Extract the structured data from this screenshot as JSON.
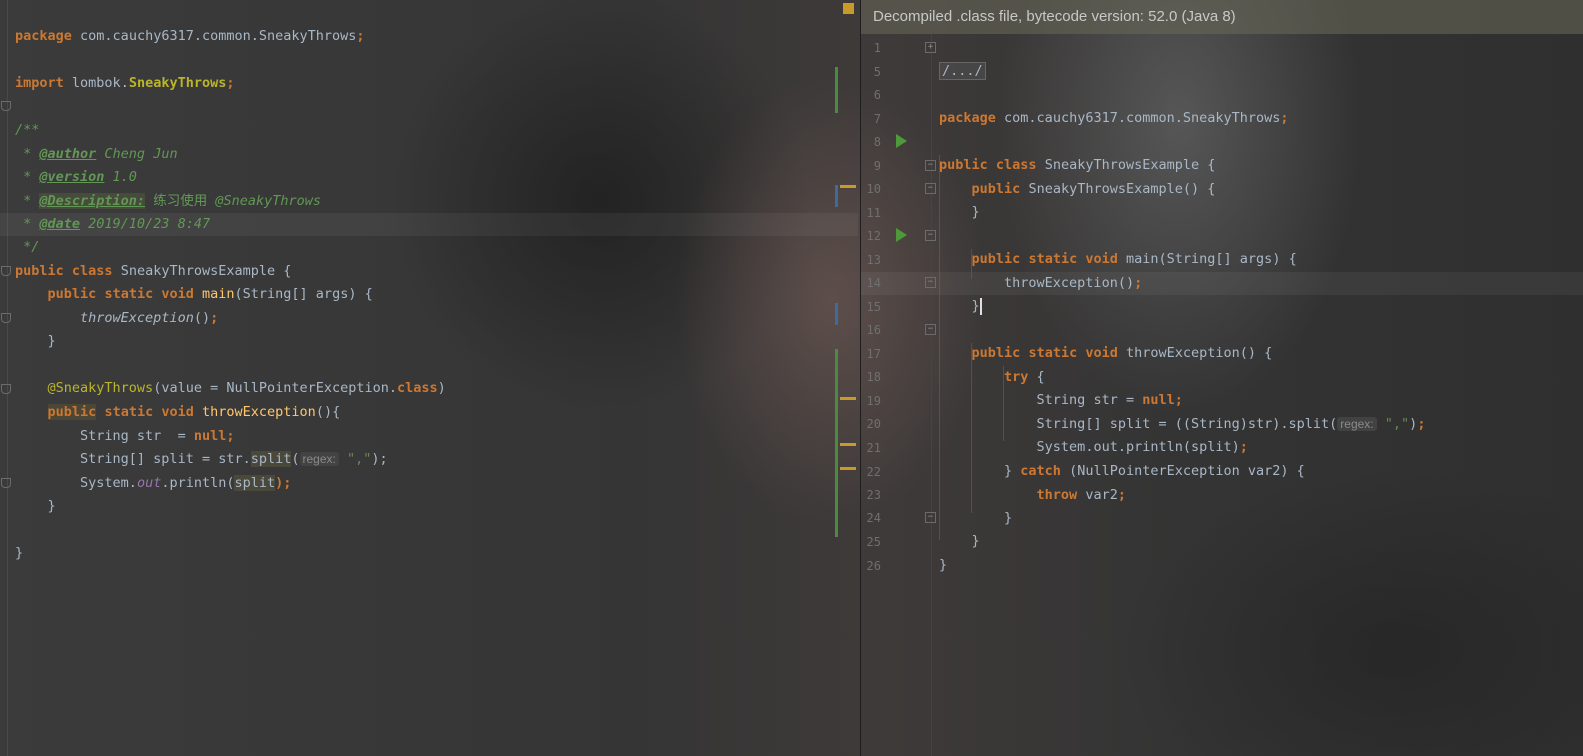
{
  "left_editor": {
    "lines": [
      {
        "row": 0,
        "kind": "package",
        "kw": "package",
        "name": "com.cauchy6317.common.SneakyThrows",
        "end": ";"
      },
      {
        "row": 2,
        "kind": "import",
        "kw": "import",
        "pre": "lombok.",
        "name": "SneakyThrows",
        "end": ";"
      },
      {
        "row": 4,
        "kind": "comment",
        "text": "/**"
      },
      {
        "row": 5,
        "kind": "doctag",
        "lead": " * ",
        "tag": "@author",
        "rest": " Cheng Jun"
      },
      {
        "row": 6,
        "kind": "doctag",
        "lead": " * ",
        "tag": "@version",
        "rest": " 1.0"
      },
      {
        "row": 7,
        "kind": "doctag2",
        "lead": " * ",
        "tag": "@Description:",
        "rest1": " 练习使用 ",
        "rest2": "@SneakyThrows"
      },
      {
        "row": 8,
        "kind": "doctag",
        "lead": " * ",
        "tag": "@date",
        "rest": " 2019/10/23 8:47"
      },
      {
        "row": 9,
        "kind": "comment",
        "text": " */"
      }
    ],
    "class_decl": {
      "kw1": "public",
      "kw2": "class",
      "name": "SneakyThrowsExample",
      "brace": "{"
    },
    "main_decl": {
      "kw1": "public",
      "kw2": "static",
      "kw3": "void",
      "fn": "main",
      "params": "(String[] args)",
      "brace": "{"
    },
    "main_call": {
      "fn": "throwException",
      "tail": "()",
      "end": ";"
    },
    "close_brace": "}",
    "annotation": {
      "name": "@SneakyThrows",
      "args_pre": "(value = NullPointerException.",
      "args_kw": "class",
      "args_post": ")"
    },
    "throw_decl": {
      "kw1": "public",
      "kw2": "static",
      "kw3": "void",
      "fn": "throwException",
      "tail": "(){"
    },
    "str_line": {
      "type": "String str  = ",
      "val": "null",
      "end": ";"
    },
    "split_line": {
      "pre": "String[] split = str.",
      "fn": "split",
      "open": "(",
      "hint": "regex:",
      "arg": "\",\"",
      "close": ");"
    },
    "print_line": {
      "pre": "System.",
      "field": "out",
      "mid": ".println(",
      "arg": "split",
      "close": ");"
    }
  },
  "right_editor": {
    "banner": "Decompiled .class file, bytecode version: 52.0 (Java 8)",
    "line_numbers": [
      "1",
      "5",
      "6",
      "7",
      "8",
      "9",
      "10",
      "11",
      "12",
      "13",
      "14",
      "15",
      "16",
      "17",
      "18",
      "19",
      "20",
      "21",
      "22",
      "23",
      "24",
      "25",
      "26"
    ],
    "folded_header": "/.../",
    "package_line": {
      "kw": "package",
      "name": "com.cauchy6317.common.SneakyThrows",
      "end": ";"
    },
    "class_line": {
      "kw1": "public",
      "kw2": "class",
      "name": "SneakyThrowsExample",
      "brace": "{"
    },
    "ctor_line": {
      "kw": "public",
      "name": "SneakyThrowsExample() {"
    },
    "main_line": {
      "kw1": "public",
      "kw2": "static",
      "kw3": "void",
      "rest": "main(String[] args) {"
    },
    "call_line": {
      "text": "throwException()",
      "end": ";"
    },
    "throw_line": {
      "kw1": "public",
      "kw2": "static",
      "kw3": "void",
      "rest": "throwException() {"
    },
    "try_line": {
      "kw": "try",
      "rest": " {"
    },
    "str_line": {
      "pre": "String str = ",
      "kw": "null",
      "end": ";"
    },
    "split_line": {
      "pre": "String[] split = ((String)str).split(",
      "hint": "regex:",
      "arg": "\",\"",
      "close": ")",
      "end": ";"
    },
    "print_line": {
      "text": "System.out.println(split)",
      "end": ";"
    },
    "catch_line": {
      "pre": "} ",
      "kw": "catch",
      "rest": " (NullPointerException var2) {"
    },
    "rethrow_line": {
      "kw": "throw",
      "rest": " var2",
      "end": ";"
    },
    "brace": "}"
  },
  "colors": {
    "keyword": "#cc7832",
    "annotation": "#bbb529",
    "comment": "#629755",
    "function": "#ffc66d",
    "string": "#6a8759",
    "field": "#9876aa"
  }
}
